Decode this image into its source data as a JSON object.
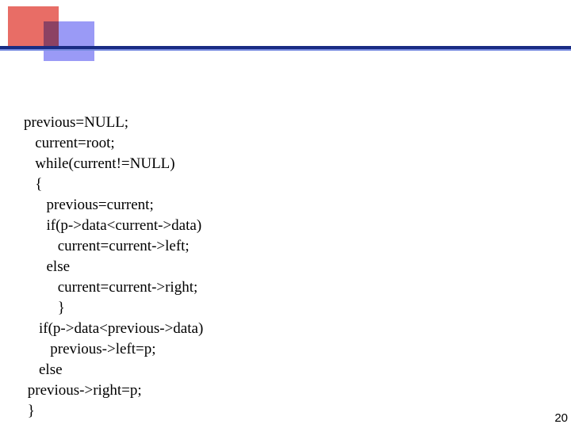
{
  "code": {
    "l1": "previous=NULL;",
    "l2": "   current=root;",
    "l3": "   while(current!=NULL)",
    "l4": "   {",
    "l5": "      previous=current;",
    "l6": "      if(p->data<current->data)",
    "l7": "         current=current->left;",
    "l8": "      else",
    "l9": "         current=current->right;",
    "l10": "         }",
    "l11": "    if(p->data<previous->data)",
    "l12": "       previous->left=p;",
    "l13": "    else",
    "l14": " previous->right=p;",
    "l15": " }"
  },
  "page_number": "20"
}
